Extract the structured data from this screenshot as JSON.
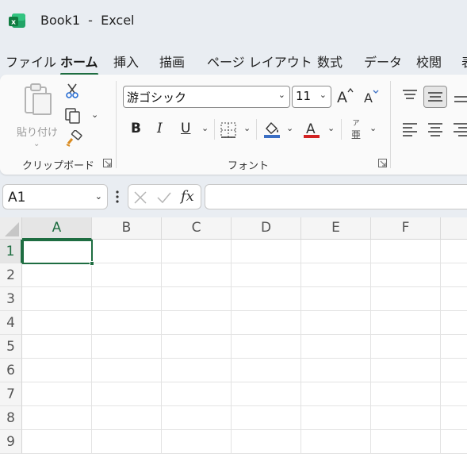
{
  "window": {
    "title": "Book1  -  Excel"
  },
  "menu": {
    "tabs": [
      {
        "label": "ファイル",
        "active": false
      },
      {
        "label": "ホーム",
        "active": true
      },
      {
        "label": "挿入",
        "active": false
      },
      {
        "label": "描画",
        "active": false
      },
      {
        "label": "ページ レイアウト",
        "active": false
      },
      {
        "label": "数式",
        "active": false
      },
      {
        "label": "データ",
        "active": false
      },
      {
        "label": "校閲",
        "active": false
      },
      {
        "label": "表",
        "active": false
      }
    ]
  },
  "ribbon": {
    "clipboard": {
      "paste_label": "貼り付け",
      "group_label": "クリップボード"
    },
    "font": {
      "font_name": "游ゴシック",
      "font_size": "11",
      "bold": "B",
      "italic": "I",
      "underline": "U",
      "phonetic_top": "ア",
      "phonetic_bottom": "亜",
      "font_color_glyph": "A",
      "group_label": "フォント"
    },
    "colors": {
      "fill": "#3b6fc4",
      "font": "#d32424",
      "accent": "#1e6d41"
    }
  },
  "formula_bar": {
    "name_box": "A1",
    "fx_label": "fx",
    "formula": ""
  },
  "sheet": {
    "columns": [
      "A",
      "B",
      "C",
      "D",
      "E",
      "F"
    ],
    "rows": [
      "1",
      "2",
      "3",
      "4",
      "5",
      "6",
      "7",
      "8",
      "9"
    ],
    "selected_column": "A",
    "selected_row": "1"
  }
}
